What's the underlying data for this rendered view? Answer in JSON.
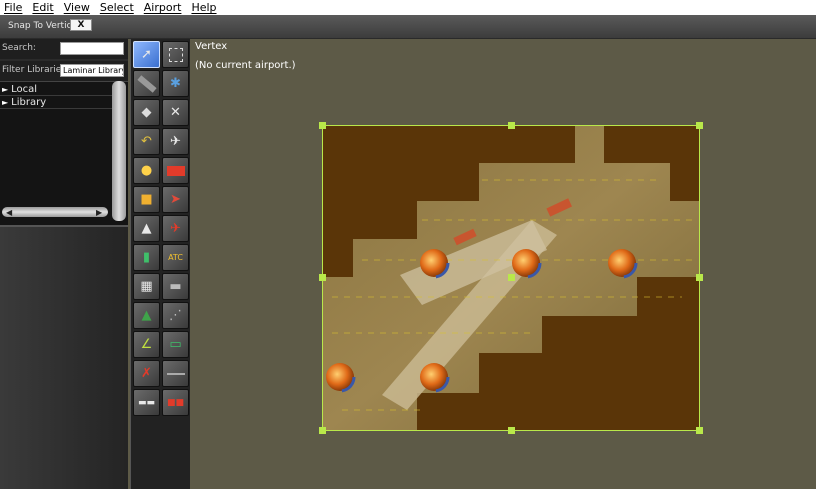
{
  "menu": {
    "items": [
      "File",
      "Edit",
      "View",
      "Select",
      "Airport",
      "Help"
    ]
  },
  "toolbar": {
    "snap_label": "Snap To Vertices",
    "snap_value": "X"
  },
  "library": {
    "search_label": "Search:",
    "search_value": "",
    "filter_label": "Filter Libraries:",
    "filter_value": "Laminar Library",
    "tree": [
      {
        "label": "Local"
      },
      {
        "label": "Library"
      }
    ]
  },
  "map": {
    "tool_name": "Vertex",
    "status": "(No current airport.)"
  },
  "colors": {
    "background": "#5d5a47",
    "selection": "#b9e84a",
    "ground_fill": "#5a3508",
    "tool_selected": "#4b84e0"
  },
  "tools": [
    "vertex-tool-icon",
    "marquee-tool-icon",
    "runway-tool-icon",
    "helipad-tool-icon",
    "taxiway-tool-icon",
    "sealane-tool-icon",
    "taxi-line-tool-icon",
    "boundary-tool-icon",
    "light-fixture-tool-icon",
    "sign-tool-icon",
    "taxi-route-tool-icon",
    "windsock-tool-icon",
    "tower-tool-icon",
    "beacon-tool-icon",
    "facade-tool-icon",
    "atc-tool-icon",
    "object-tool-icon",
    "forest-tool-icon",
    "line-tool-icon",
    "polygon-tool-icon",
    "string-tool-icon",
    "exclusion-tool-icon",
    "ramp-start-tool-icon",
    "truck-tool-icon"
  ]
}
